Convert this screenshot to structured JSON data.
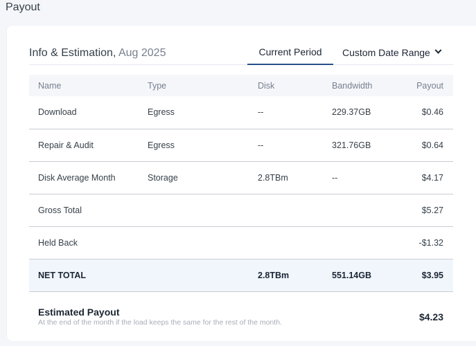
{
  "page_title": "Payout",
  "header": {
    "title": "Info & Estimation,",
    "period": "Aug 2025",
    "tabs": {
      "current": "Current Period",
      "custom": "Custom Date Range"
    }
  },
  "table": {
    "columns": [
      "Name",
      "Type",
      "Disk",
      "Bandwidth",
      "Payout"
    ],
    "rows": [
      {
        "name": "Download",
        "type": "Egress",
        "disk": "--",
        "bandwidth": "229.37GB",
        "payout": "$0.46"
      },
      {
        "name": "Repair & Audit",
        "type": "Egress",
        "disk": "--",
        "bandwidth": "321.76GB",
        "payout": "$0.64"
      },
      {
        "name": "Disk Average Month",
        "type": "Storage",
        "disk": "2.8TBm",
        "bandwidth": "--",
        "payout": "$4.17"
      },
      {
        "name": "Gross Total",
        "type": "",
        "disk": "",
        "bandwidth": "",
        "payout": "$5.27"
      },
      {
        "name": "Held Back",
        "type": "",
        "disk": "",
        "bandwidth": "",
        "payout": "-$1.32"
      }
    ],
    "net": {
      "name": "NET TOTAL",
      "disk": "2.8TBm",
      "bandwidth": "551.14GB",
      "payout": "$3.95"
    }
  },
  "estimate": {
    "title": "Estimated Payout",
    "subtitle": "At the end of the month if the load keeps the same for the rest of the month.",
    "value": "$4.23"
  }
}
